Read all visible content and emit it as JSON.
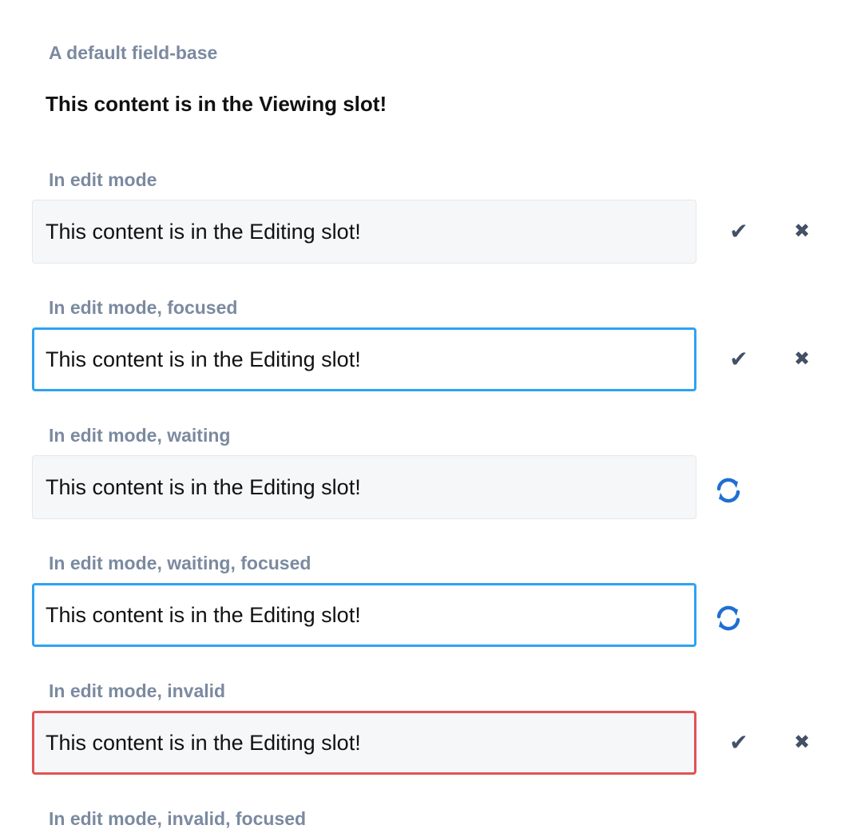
{
  "sections": {
    "default": {
      "label": "A default field-base",
      "viewing_text": "This content is in the Viewing slot!"
    },
    "edit": {
      "label": "In edit mode",
      "value": "This content is in the Editing slot!",
      "confirm_icon": "check-icon",
      "cancel_icon": "close-icon"
    },
    "edit_focused": {
      "label": "In edit mode, focused",
      "value": "This content is in the Editing slot!",
      "confirm_icon": "check-icon",
      "cancel_icon": "close-icon"
    },
    "edit_waiting": {
      "label": "In edit mode, waiting",
      "value": "This content is in the Editing slot!",
      "status_icon": "refresh-icon"
    },
    "edit_waiting_focused": {
      "label": "In edit mode, waiting, focused",
      "value": "This content is in the Editing slot!",
      "status_icon": "refresh-icon"
    },
    "edit_invalid": {
      "label": "In edit mode, invalid",
      "value": "This content is in the Editing slot!",
      "confirm_icon": "check-icon",
      "cancel_icon": "close-icon"
    },
    "edit_invalid_focused": {
      "label": "In edit mode, invalid, focused"
    }
  },
  "colors": {
    "label": "#7b8aa0",
    "focus_border": "#2ea3f2",
    "invalid_border": "#e05454",
    "field_background": "#f6f7f9",
    "action_icon": "#435066",
    "spinner": "#1f6fd1"
  }
}
